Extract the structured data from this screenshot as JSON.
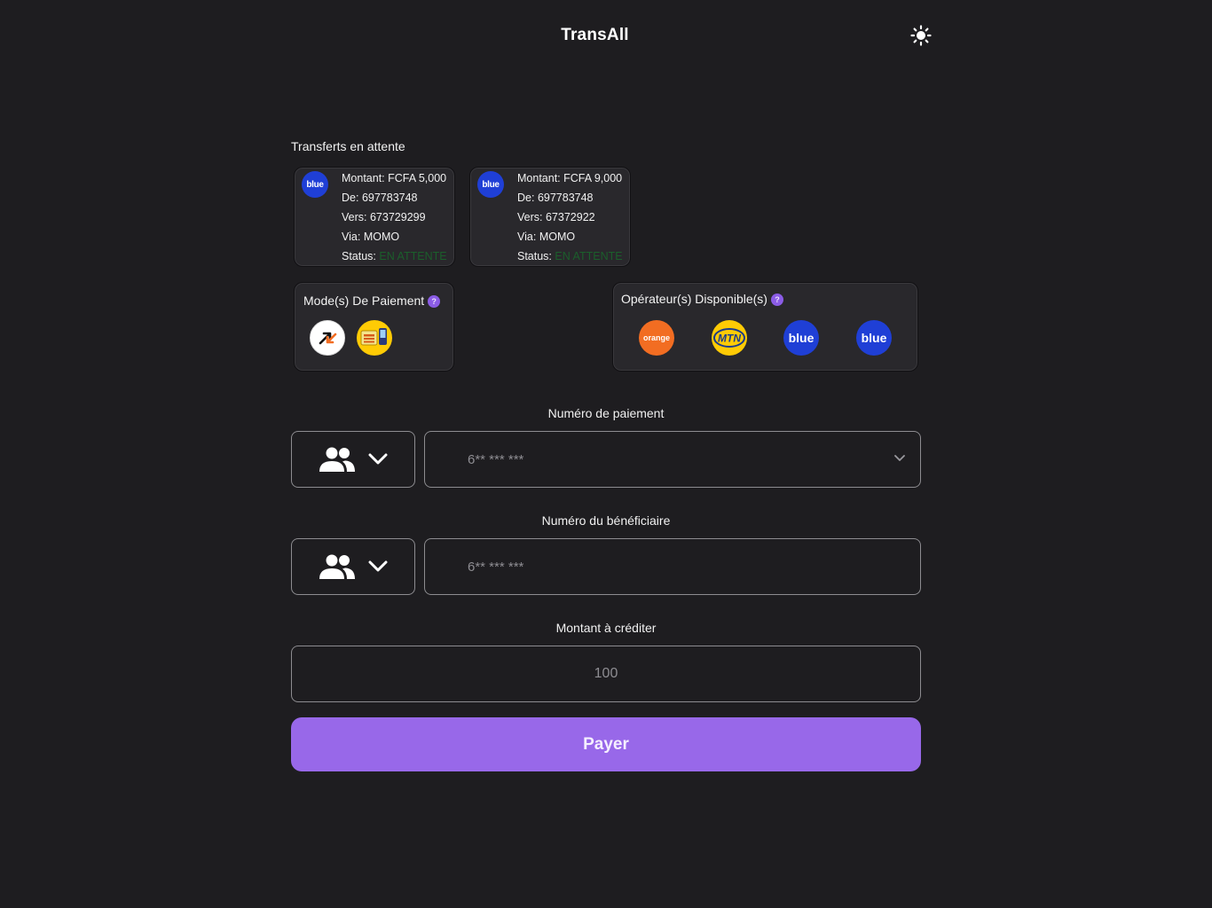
{
  "app": {
    "title": "TransAll"
  },
  "theme_toggle": {
    "icon": "sun-icon"
  },
  "pending": {
    "title": "Transferts en attente",
    "transfers": [
      {
        "operator_logo": "blue",
        "amount_label": "Montant:",
        "amount": "FCFA 5,000",
        "from_label": "De:",
        "from": "697783748",
        "to_label": "Vers:",
        "to": "673729299",
        "via_label": "Via:",
        "via": "MOMO",
        "status_label": "Status:",
        "status": "EN ATTENTE"
      },
      {
        "operator_logo": "blue",
        "amount_label": "Montant:",
        "amount": "FCFA 9,000",
        "from_label": "De:",
        "from": "697783748",
        "to_label": "Vers:",
        "to": "67372922",
        "via_label": "Via:",
        "via": "MOMO",
        "status_label": "Status:",
        "status": "EN ATTENTE"
      }
    ]
  },
  "payment_modes": {
    "title": "Mode(s) De Paiement",
    "help": "?",
    "items": [
      "orange-money-icon",
      "mtn-mobile-money-icon"
    ]
  },
  "operators": {
    "title": "Opérateur(s) Disponible(s)",
    "help": "?",
    "items": [
      {
        "name": "orange",
        "label": "orange"
      },
      {
        "name": "mtn",
        "label": "MTN"
      },
      {
        "name": "blue",
        "label": "blue"
      },
      {
        "name": "blue",
        "label": "blue"
      }
    ]
  },
  "payment_number": {
    "label": "Numéro de paiement",
    "placeholder": "6** *** ***"
  },
  "beneficiary_number": {
    "label": "Numéro du bénéficiaire",
    "placeholder": "6** *** ***"
  },
  "amount": {
    "label": "Montant à créditer",
    "placeholder": "100"
  },
  "pay_button": {
    "label": "Payer"
  },
  "colors": {
    "background": "#1e1d20",
    "accent": "#9868e9",
    "blue_operator": "#1f3fd6",
    "orange_operator": "#f26d22",
    "mtn_operator": "#ffcb05",
    "status_pending": "#1b5e2b"
  }
}
